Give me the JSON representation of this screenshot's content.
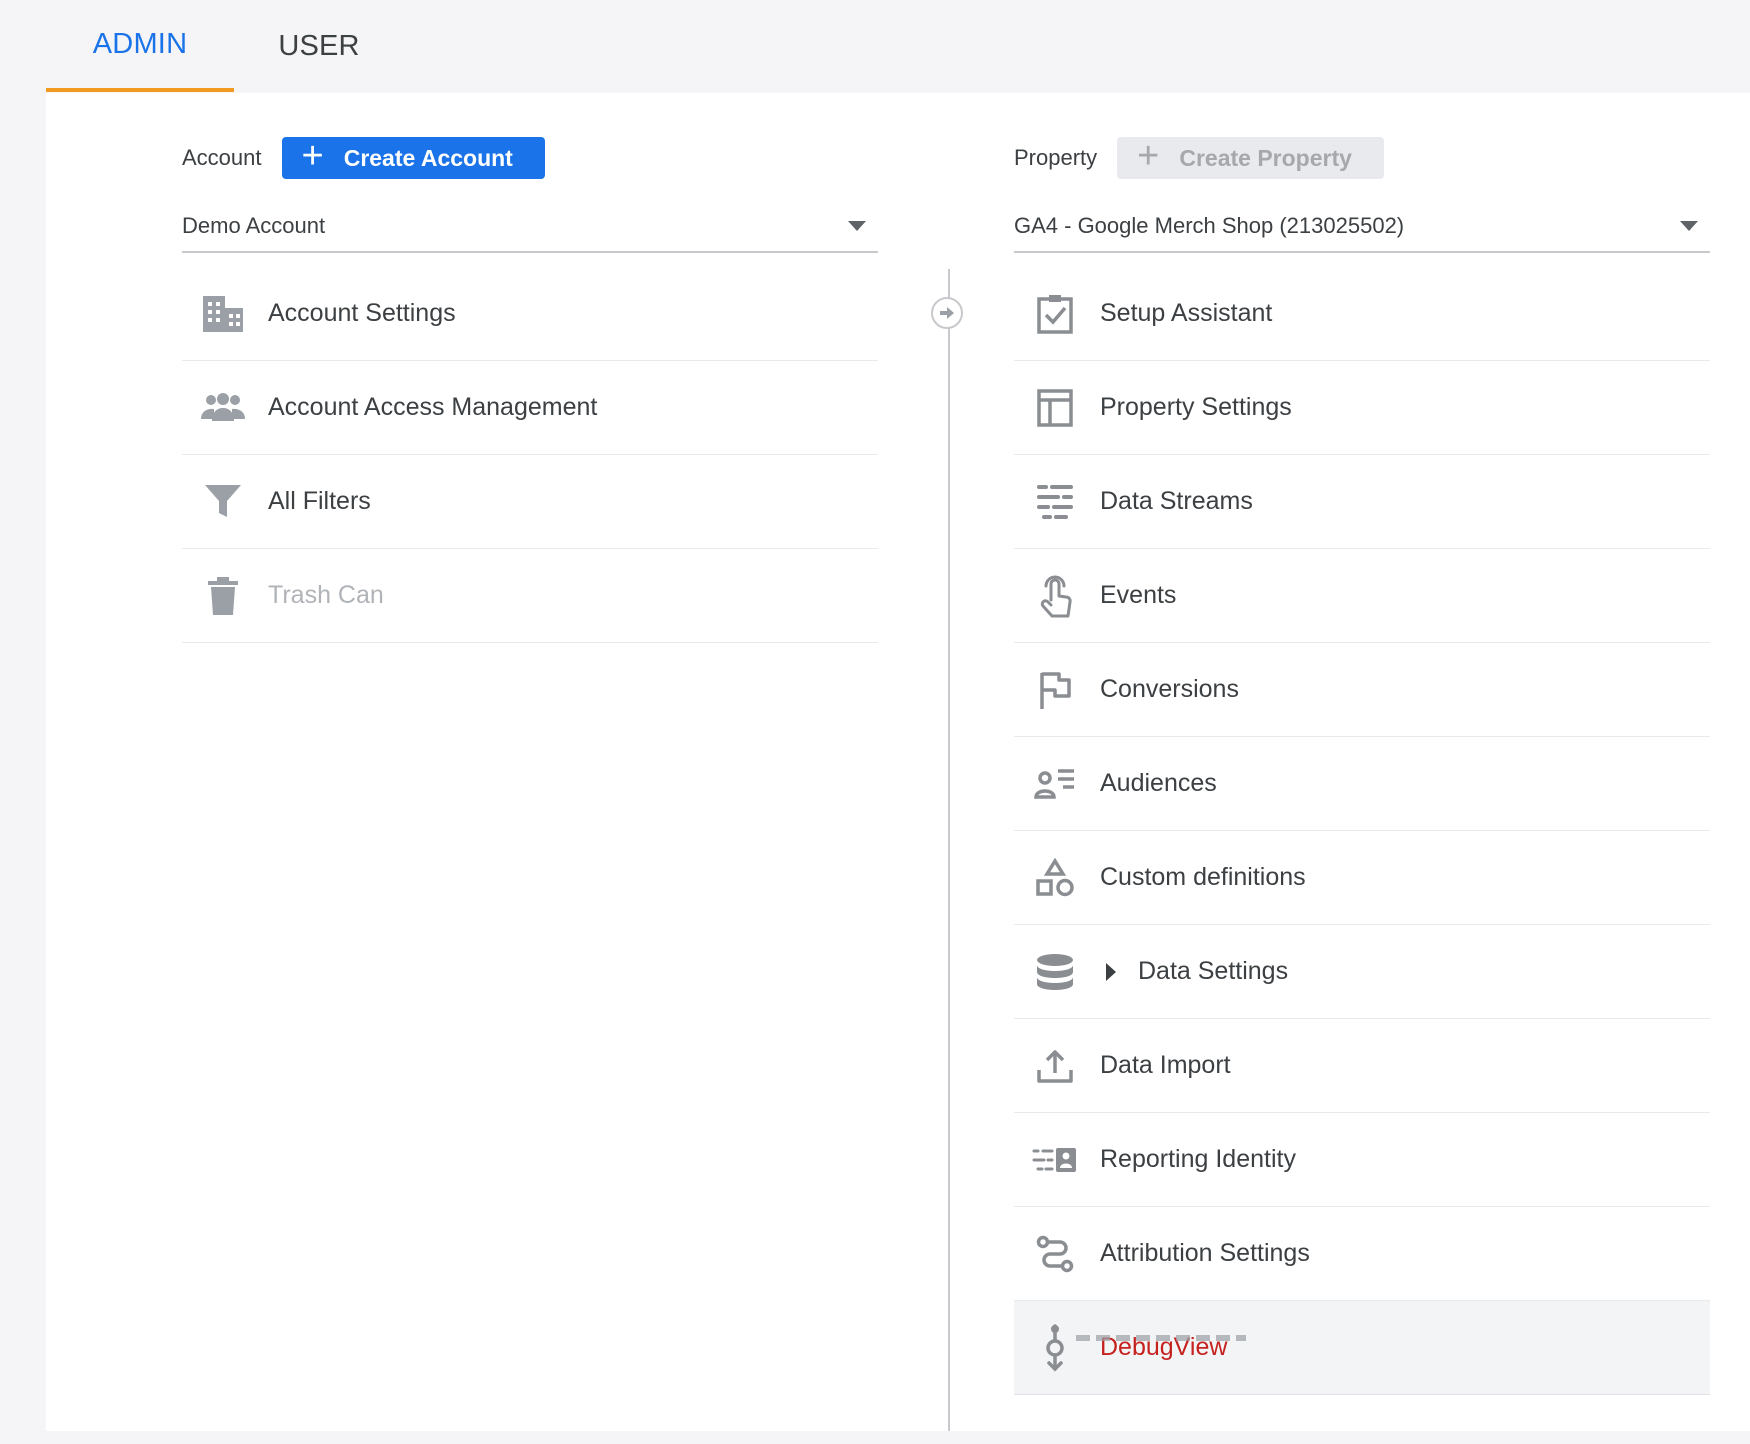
{
  "tabs": {
    "admin": "ADMIN",
    "user": "USER"
  },
  "account": {
    "label": "Account",
    "create_button": "Create Account",
    "selected": "Demo Account",
    "items": [
      {
        "label": "Account Settings",
        "icon": "building-icon"
      },
      {
        "label": "Account Access Management",
        "icon": "people-icon"
      },
      {
        "label": "All Filters",
        "icon": "filter-icon"
      },
      {
        "label": "Trash Can",
        "icon": "trash-icon"
      }
    ]
  },
  "property": {
    "label": "Property",
    "create_button": "Create Property",
    "selected": "GA4 - Google Merch Shop (213025502)",
    "items": [
      {
        "label": "Setup Assistant",
        "icon": "clipboard-check-icon"
      },
      {
        "label": "Property Settings",
        "icon": "layout-icon"
      },
      {
        "label": "Data Streams",
        "icon": "data-streams-icon"
      },
      {
        "label": "Events",
        "icon": "touch-icon"
      },
      {
        "label": "Conversions",
        "icon": "flag-icon"
      },
      {
        "label": "Audiences",
        "icon": "audience-list-icon"
      },
      {
        "label": "Custom definitions",
        "icon": "shapes-icon"
      },
      {
        "label": "Data Settings",
        "icon": "database-icon"
      },
      {
        "label": "Data Import",
        "icon": "upload-icon"
      },
      {
        "label": "Reporting Identity",
        "icon": "identity-icon"
      },
      {
        "label": "Attribution Settings",
        "icon": "route-icon"
      },
      {
        "label": "DebugView",
        "icon": "debug-icon"
      }
    ]
  },
  "colors": {
    "accent": "#1a73e8",
    "tab_indicator": "#f29a1f",
    "debug_text": "#c5221f",
    "icon": "#8a8d91"
  }
}
